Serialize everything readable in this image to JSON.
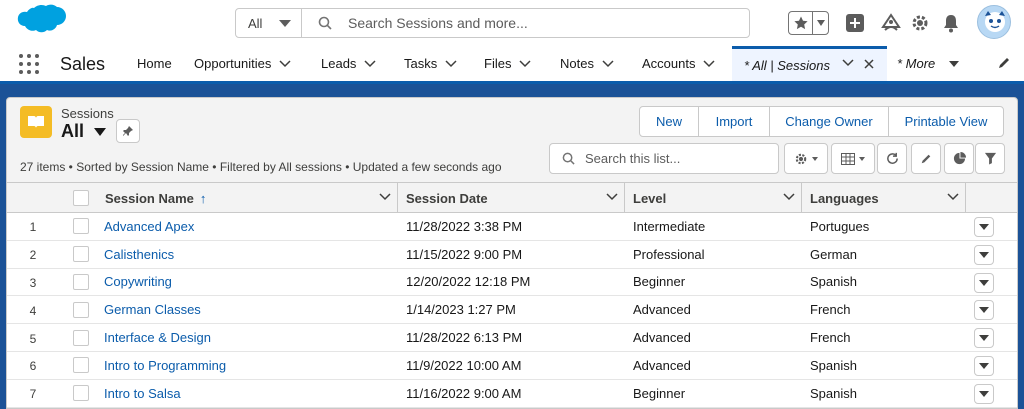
{
  "header": {
    "search_scope": "All",
    "search_placeholder": "Search Sessions and more...",
    "icons": [
      "salesforce-cloud-logo",
      "star-icon",
      "add-icon",
      "trailhead-icon",
      "gear-icon",
      "bell-icon",
      "avatar"
    ]
  },
  "nav": {
    "app_name": "Sales",
    "items": [
      {
        "label": "Home",
        "dropdown": false
      },
      {
        "label": "Opportunities",
        "dropdown": true
      },
      {
        "label": "Leads",
        "dropdown": true
      },
      {
        "label": "Tasks",
        "dropdown": true
      },
      {
        "label": "Files",
        "dropdown": true
      },
      {
        "label": "Notes",
        "dropdown": true
      },
      {
        "label": "Accounts",
        "dropdown": true
      }
    ],
    "active_tab": "* All | Sessions",
    "more": "* More"
  },
  "list": {
    "object_label": "Sessions",
    "view_name": "All",
    "buttons": [
      "New",
      "Import",
      "Change Owner",
      "Printable View"
    ],
    "meta": "27 items • Sorted by Session Name • Filtered by All sessions • Updated a few seconds ago",
    "search_placeholder": "Search this list..."
  },
  "table": {
    "columns": [
      "Session Name",
      "Session Date",
      "Level",
      "Languages"
    ],
    "sort_indicator": "↑",
    "rows": [
      {
        "num": "1",
        "name": "Advanced Apex",
        "date": "11/28/2022 3:38 PM",
        "level": "Intermediate",
        "lang": "Portugues"
      },
      {
        "num": "2",
        "name": "Calisthenics",
        "date": "11/15/2022 9:00 PM",
        "level": "Professional",
        "lang": "German"
      },
      {
        "num": "3",
        "name": "Copywriting",
        "date": "12/20/2022 12:18 PM",
        "level": "Beginner",
        "lang": "Spanish"
      },
      {
        "num": "4",
        "name": "German Classes",
        "date": "1/14/2023 1:27 PM",
        "level": "Advanced",
        "lang": "French"
      },
      {
        "num": "5",
        "name": "Interface & Design",
        "date": "11/28/2022 6:13 PM",
        "level": "Advanced",
        "lang": "French"
      },
      {
        "num": "6",
        "name": "Intro to Programming",
        "date": "11/9/2022 10:00 AM",
        "level": "Advanced",
        "lang": "Spanish"
      },
      {
        "num": "7",
        "name": "Intro to Salsa",
        "date": "11/16/2022 9:00 AM",
        "level": "Beginner",
        "lang": "Spanish"
      }
    ]
  },
  "colors": {
    "brand_blue": "#0b5cab",
    "backdrop": "#1b5297",
    "object_icon": "#f4bc25"
  }
}
